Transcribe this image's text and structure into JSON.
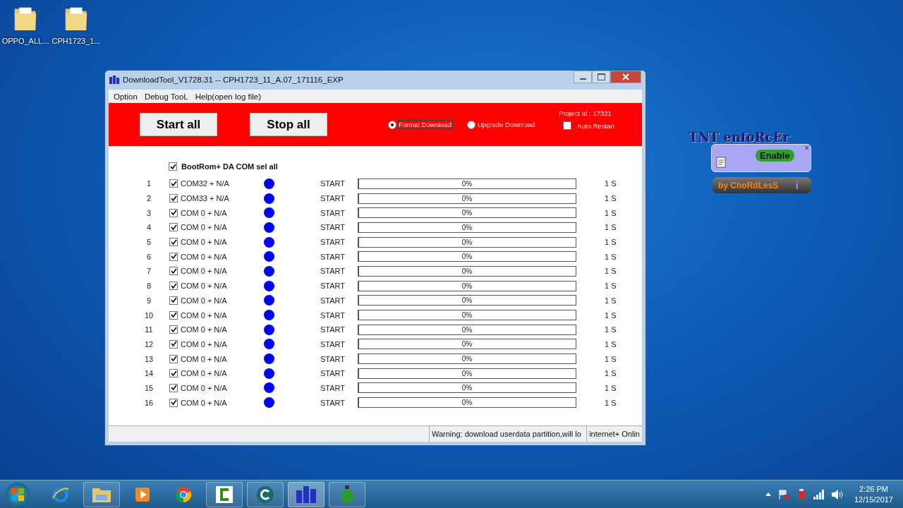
{
  "desktop_icons": [
    {
      "label": "OPPO_ALL..."
    },
    {
      "label": "CPH1723_1..."
    }
  ],
  "window": {
    "title": "DownloadTool_V1728.31 -- CPH1723_11_A.07_171116_EXP",
    "menu": [
      "Option",
      "Debug TooL",
      "Help(open log file)"
    ],
    "buttons": [
      "Start all",
      "Stop all"
    ],
    "modes": [
      {
        "label": "Format Download",
        "selected": true
      },
      {
        "label": "Upgrade Download",
        "selected": false
      }
    ],
    "project_id": "Project Id : 17321",
    "auto_restart": {
      "label": "Auto Restart",
      "checked": false
    },
    "select_all": {
      "label": "BootRom+ DA COM sel all",
      "checked": true
    },
    "ports": [
      {
        "number": "1",
        "checked": true,
        "port": "COM32 + N/A",
        "color": "#0000ff",
        "status": "START",
        "level": 0,
        "percent": "0%",
        "time": "1 S"
      },
      {
        "number": "2",
        "checked": true,
        "port": "COM33 + N/A",
        "color": "#0000ff",
        "status": "START",
        "level": 0,
        "percent": "0%",
        "time": "1 S"
      },
      {
        "number": "3",
        "checked": true,
        "port": "COM 0 + N/A",
        "color": "#0000ff",
        "status": "START",
        "level": 0,
        "percent": "0%",
        "time": "1 S"
      },
      {
        "number": "4",
        "checked": true,
        "port": "COM 0 + N/A",
        "color": "#0000ff",
        "status": "START",
        "level": 0,
        "percent": "0%",
        "time": "1 S"
      },
      {
        "number": "5",
        "checked": true,
        "port": "COM 0 + N/A",
        "color": "#0000ff",
        "status": "START",
        "level": 0,
        "percent": "0%",
        "time": "1 S"
      },
      {
        "number": "6",
        "checked": true,
        "port": "COM 0 + N/A",
        "color": "#0000ff",
        "status": "START",
        "level": 0,
        "percent": "0%",
        "time": "1 S"
      },
      {
        "number": "7",
        "checked": true,
        "port": "COM 0 + N/A",
        "color": "#0000ff",
        "status": "START",
        "level": 0,
        "percent": "0%",
        "time": "1 S"
      },
      {
        "number": "8",
        "checked": true,
        "port": "COM 0 + N/A",
        "color": "#0000ff",
        "status": "START",
        "level": 0,
        "percent": "0%",
        "time": "1 S"
      },
      {
        "number": "9",
        "checked": true,
        "port": "COM 0 + N/A",
        "color": "#0000ff",
        "status": "START",
        "level": 0,
        "percent": "0%",
        "time": "1 S"
      },
      {
        "number": "10",
        "checked": true,
        "port": "COM 0 + N/A",
        "color": "#0000ff",
        "status": "START",
        "level": 0,
        "percent": "0%",
        "time": "1 S"
      },
      {
        "number": "11",
        "checked": true,
        "port": "COM 0 + N/A",
        "color": "#0000ff",
        "status": "START",
        "level": 0,
        "percent": "0%",
        "time": "1 S"
      },
      {
        "number": "12",
        "checked": true,
        "port": "COM 0 + N/A",
        "color": "#0000ff",
        "status": "START",
        "level": 0,
        "percent": "0%",
        "time": "1 S"
      },
      {
        "number": "13",
        "checked": true,
        "port": "COM 0 + N/A",
        "color": "#0000ff",
        "status": "START",
        "level": 0,
        "percent": "0%",
        "time": "1 S"
      },
      {
        "number": "14",
        "checked": true,
        "port": "COM 0 + N/A",
        "color": "#0000ff",
        "status": "START",
        "level": 0,
        "percent": "0%",
        "time": "1 S"
      },
      {
        "number": "15",
        "checked": true,
        "port": "COM 0 + N/A",
        "color": "#0000ff",
        "status": "START",
        "level": 0,
        "percent": "0%",
        "time": "1 S"
      },
      {
        "number": "16",
        "checked": true,
        "port": "COM 0 + N/A",
        "color": "#0000ff",
        "status": "START",
        "level": 0,
        "percent": "0%",
        "time": "1 S"
      }
    ],
    "status_bar": [
      "Warning: download userdata partition,will lo",
      "internet+ Onlin"
    ]
  },
  "gadget": {
    "title": "TNT enfoRcEr",
    "state": "Enable",
    "credit": "by ChoRdLesS",
    "info": "i",
    "close": "×"
  },
  "taskbar": {
    "time": "2:26 PM",
    "date": "12/15/2017"
  }
}
